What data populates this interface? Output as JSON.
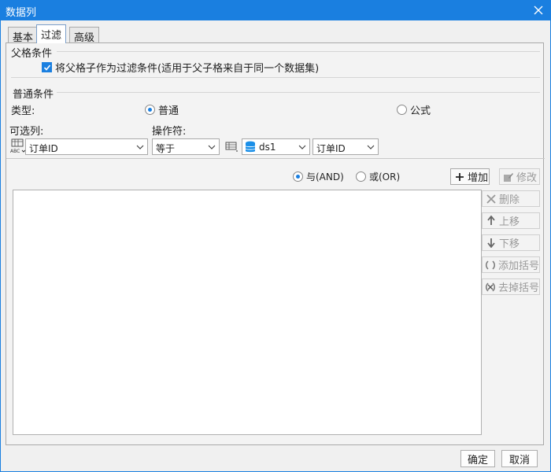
{
  "window": {
    "title": "数据列"
  },
  "tabs": [
    {
      "label": "基本"
    },
    {
      "label": "过滤"
    },
    {
      "label": "高级"
    }
  ],
  "parent_section": {
    "title": "父格条件",
    "checkbox_label": "将父格子作为过滤条件(适用于父子格来自于同一个数据集)"
  },
  "normal_section": {
    "title": "普通条件",
    "type_label": "类型:",
    "radio_normal": "普通",
    "radio_formula": "公式",
    "column_label": "可选列:",
    "operator_label": "操作符:",
    "column_value": "订单ID",
    "operator_value": "等于",
    "dataset_value": "ds1",
    "field_value": "订单ID"
  },
  "logic": {
    "and_label": "与(AND)",
    "or_label": "或(OR)"
  },
  "buttons": {
    "add": "增加",
    "modify": "修改",
    "delete": "删除",
    "up": "上移",
    "down": "下移",
    "add_bracket": "添加括号",
    "remove_bracket": "去掉括号"
  },
  "footer": {
    "ok": "确定",
    "cancel": "取消"
  },
  "colors": {
    "titlebar": "#1a7fe0",
    "accent": "#1a7fe0"
  }
}
